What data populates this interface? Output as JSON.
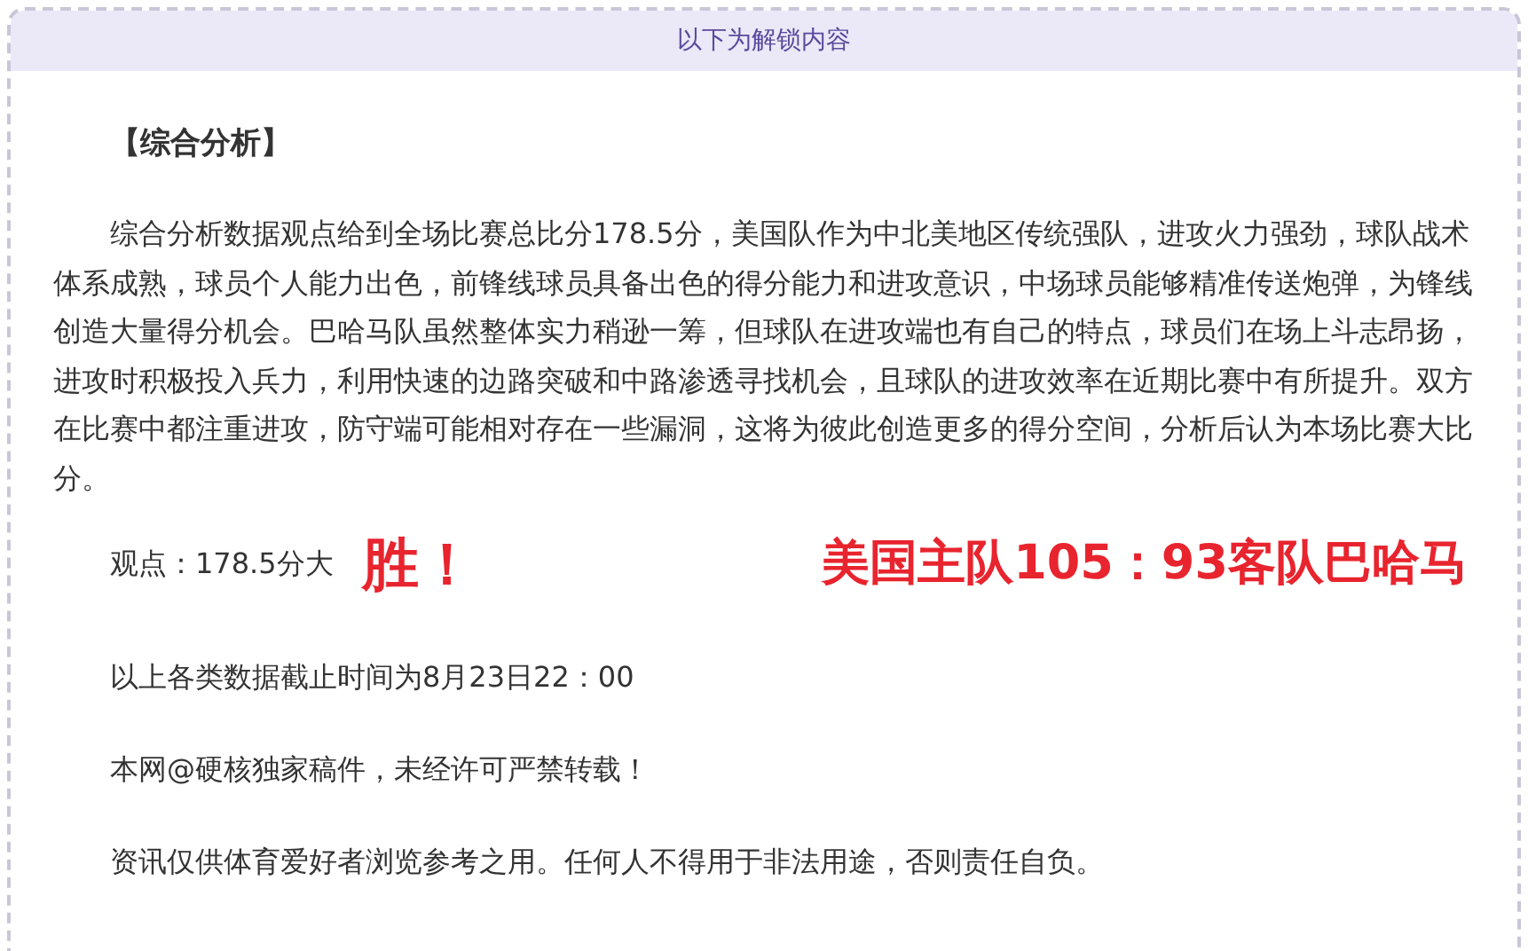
{
  "banner": {
    "text": "以下为解锁内容"
  },
  "section_title": "【综合分析】",
  "analysis": "综合分析数据观点给到全场比赛总比分178.5分，美国队作为中北美地区传统强队，进攻火力强劲，球队战术体系成熟，球员个人能力出色，前锋线球员具备出色的得分能力和进攻意识，中场球员能够精准传送炮弹，为锋线创造大量得分机会。巴哈马队虽然整体实力稍逊一筹，但球队在进攻端也有自己的特点，球员们在场上斗志昂扬，进攻时积极投入兵力，利用快速的边路突破和中路渗透寻找机会，且球队的进攻效率在近期比赛中有所提升。双方在比赛中都注重进攻，防守端可能相对存在一些漏洞，这将为彼此创造更多的得分空间，分析后认为本场比赛大比分。",
  "verdict": {
    "text": "观点：178.5分大",
    "stamp": "胜！",
    "score": "美国主队105：93客队巴哈马"
  },
  "notes": [
    "以上各类数据截止时间为8月23日22：00",
    "本网@硬核独家稿件，未经许可严禁转载！",
    "资讯仅供体育爱好者浏览参考之用。任何人不得用于非法用途，否则责任自负。"
  ]
}
